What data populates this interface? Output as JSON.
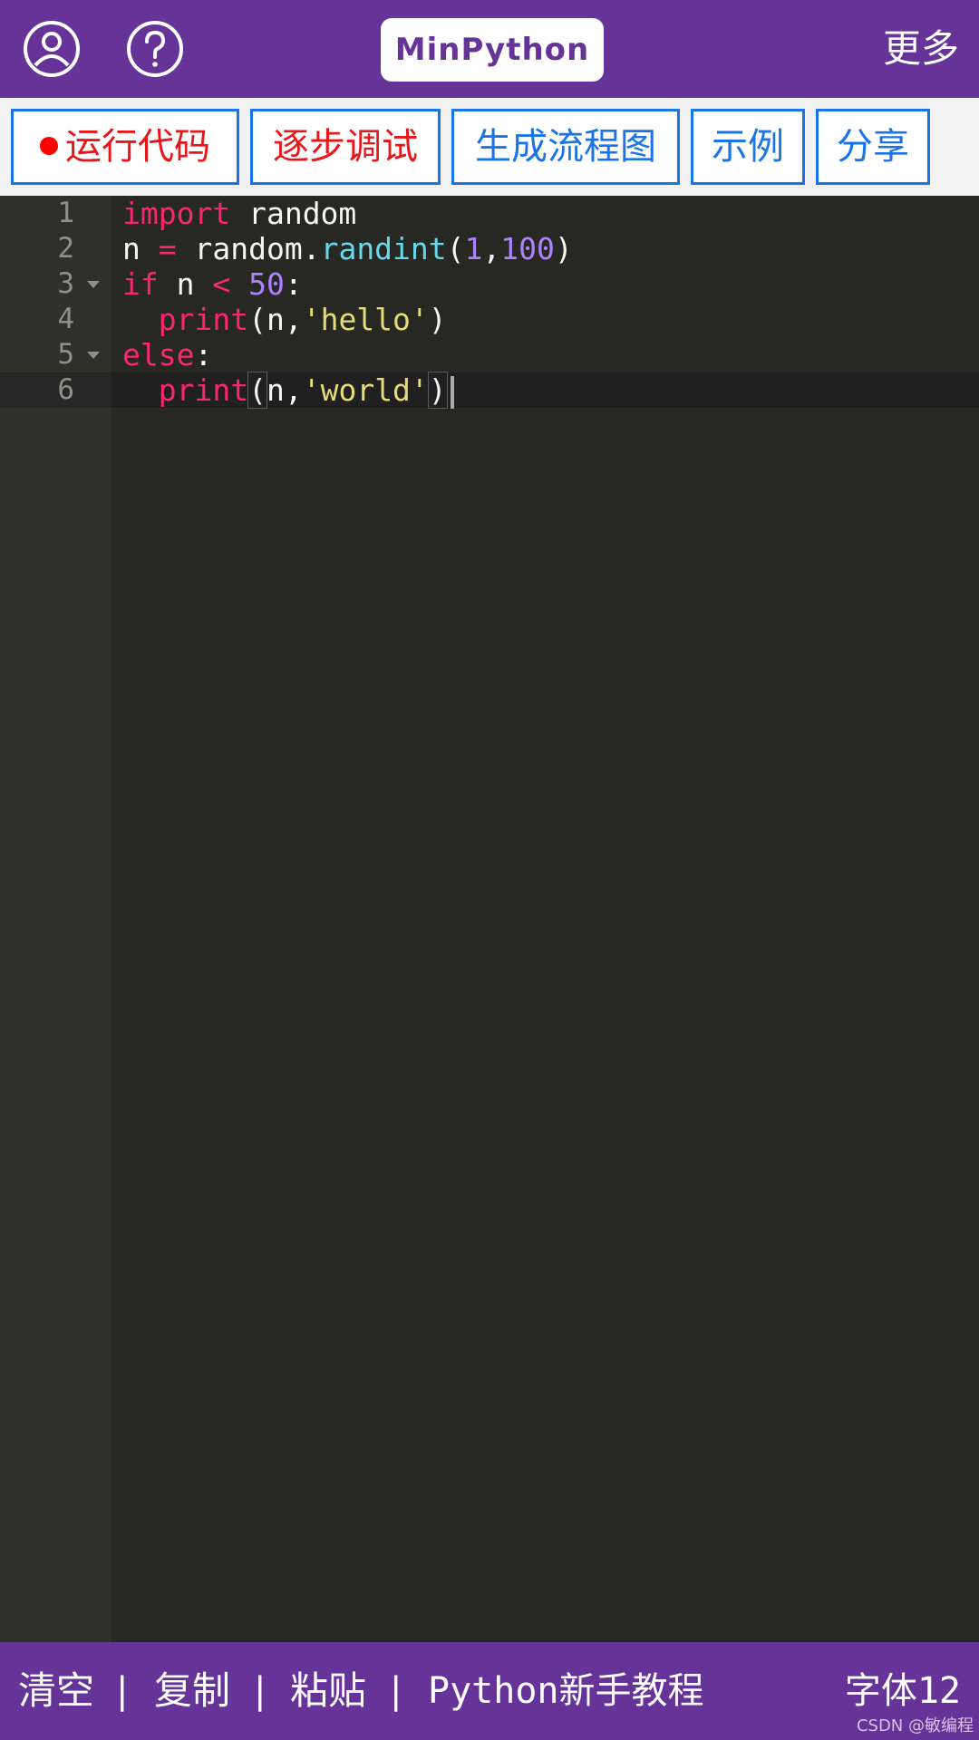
{
  "header": {
    "logo": "MinPython",
    "more": "更多",
    "icons": [
      "user-icon",
      "help-icon"
    ]
  },
  "toolbar": {
    "run": "运行代码",
    "step": "逐步调试",
    "flowchart": "生成流程图",
    "examples": "示例",
    "share": "分享"
  },
  "editor": {
    "lines": [
      {
        "n": "1"
      },
      {
        "n": "2"
      },
      {
        "n": "3"
      },
      {
        "n": "4"
      },
      {
        "n": "5"
      },
      {
        "n": "6"
      }
    ],
    "tokens": {
      "l1": [
        "import",
        " random"
      ],
      "l2": [
        "n ",
        "=",
        " random.",
        "randint",
        "(",
        "1",
        ",",
        "100",
        ")"
      ],
      "l3": [
        "if",
        " n ",
        "<",
        " ",
        "50",
        ":"
      ],
      "l4": [
        "  ",
        "print",
        "(n,",
        "'hello'",
        ")"
      ],
      "l5": [
        "else",
        ":"
      ],
      "l6": [
        "  ",
        "print",
        "(",
        "n,",
        "'world'",
        ")"
      ]
    }
  },
  "footer": {
    "clear": "清空",
    "sep": "|",
    "copy": "复制",
    "paste": "粘贴",
    "tutorial": "Python新手教程",
    "font_label": "字体",
    "font_size": "12"
  },
  "watermark": "CSDN @敏编程",
  "colors": {
    "brand": "#663399",
    "accent_blue": "#1a73e8",
    "accent_red": "#e8151b",
    "editor_bg": "#272822"
  }
}
